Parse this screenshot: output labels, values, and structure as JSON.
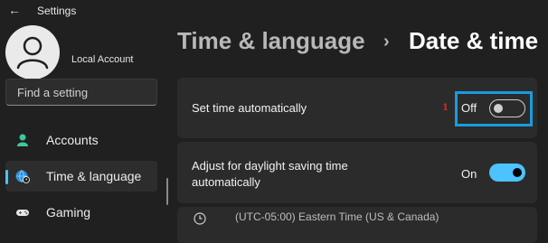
{
  "window": {
    "title": "Settings"
  },
  "account": {
    "name": "Local Account"
  },
  "search": {
    "placeholder": "Find a setting"
  },
  "sidebar": {
    "items": [
      {
        "label": "Accounts",
        "icon": "person-icon",
        "active": false
      },
      {
        "label": "Time & language",
        "icon": "globe-clock-icon",
        "active": true
      },
      {
        "label": "Gaming",
        "icon": "gamepad-icon",
        "active": false
      }
    ]
  },
  "breadcrumb": {
    "parent": "Time & language",
    "separator": "›",
    "current": "Date & time"
  },
  "settings": {
    "set_time_automatically": {
      "label": "Set time automatically",
      "state_text": "Off",
      "on": false
    },
    "daylight_saving": {
      "label_line1": "Adjust for daylight saving time",
      "label_line2": "automatically",
      "state_text": "On",
      "on": true
    },
    "time_zone": {
      "text": "(UTC-05:00) Eastern Time (US & Canada)"
    }
  },
  "annotation": {
    "step_number": "1"
  },
  "colors": {
    "accent": "#4cc2ff",
    "highlight": "#1a9be0",
    "step_number": "#e0271f",
    "background": "#202020",
    "card": "#2b2b2b"
  }
}
